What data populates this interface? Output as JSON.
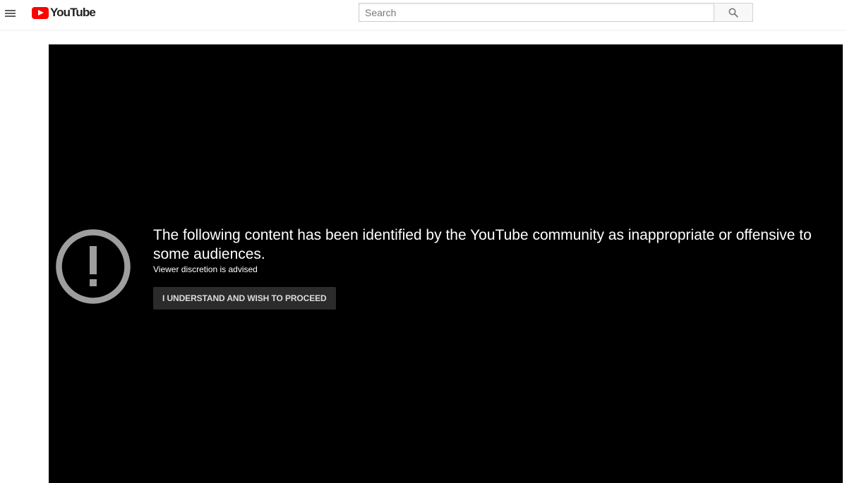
{
  "masthead": {
    "menu_icon": "hamburger-menu-icon",
    "logo_text": "YouTube",
    "brand_color": "#ff0000",
    "search": {
      "placeholder": "Search",
      "value": "",
      "button_icon": "search-icon"
    }
  },
  "player": {
    "background": "#000000",
    "warning": {
      "icon": "exclamation-circle-icon",
      "title": "The following content has been identified by the YouTube community as inappropriate or offensive to some audiences.",
      "subtitle": "Viewer discretion is advised",
      "proceed_label": "I UNDERSTAND AND WISH TO PROCEED"
    }
  }
}
